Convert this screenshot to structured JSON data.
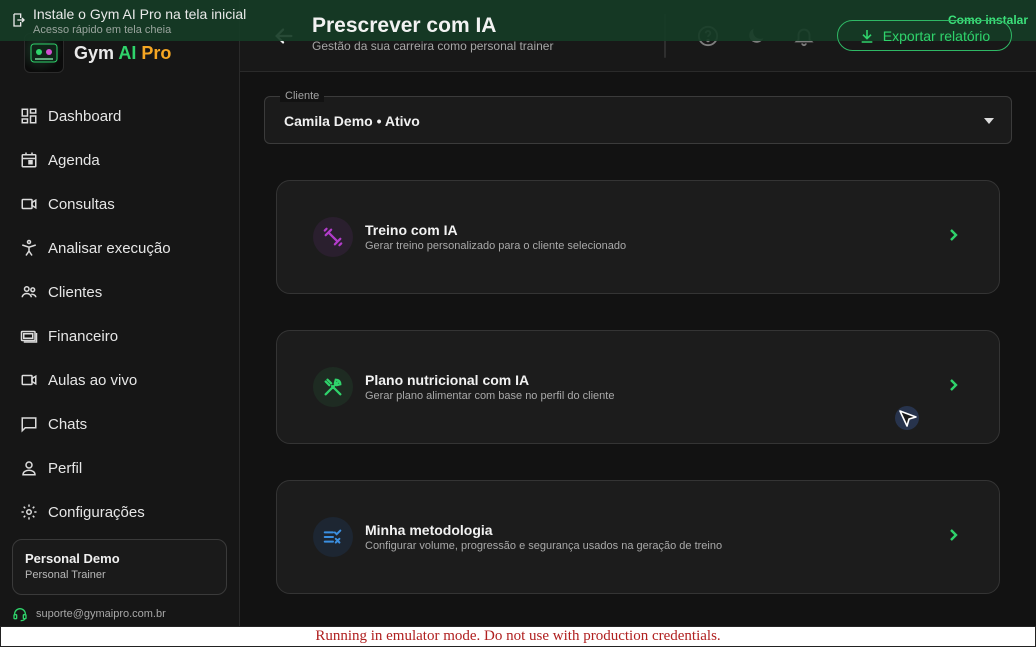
{
  "install_banner": {
    "title": "Instale o Gym AI Pro na tela inicial",
    "subtitle": "Acesso rápido em tela cheia",
    "action": "Como instalar"
  },
  "brand": {
    "name_part1": "Gym ",
    "name_part2": "AI",
    "name_part3": " Pro"
  },
  "sidebar": {
    "items": [
      {
        "label": "Dashboard",
        "icon": "dashboard-icon"
      },
      {
        "label": "Agenda",
        "icon": "calendar-icon"
      },
      {
        "label": "Consultas",
        "icon": "video-icon"
      },
      {
        "label": "Analisar execução",
        "icon": "gymnast-icon"
      },
      {
        "label": "Clientes",
        "icon": "people-icon"
      },
      {
        "label": "Financeiro",
        "icon": "money-icon"
      },
      {
        "label": "Aulas ao vivo",
        "icon": "live-video-icon"
      },
      {
        "label": "Chats",
        "icon": "chat-icon"
      },
      {
        "label": "Perfil",
        "icon": "person-icon"
      },
      {
        "label": "Configurações",
        "icon": "gear-icon"
      }
    ],
    "user": {
      "name": "Personal Demo",
      "role": "Personal Trainer"
    },
    "support_email": "suporte@gymaipro.com.br"
  },
  "header": {
    "title": "Prescrever com IA",
    "subtitle": "Gestão da sua carreira como personal trainer",
    "export_label": "Exportar relatório"
  },
  "client_select": {
    "legend": "Cliente",
    "value": "Camila Demo • Ativo"
  },
  "cards": [
    {
      "title": "Treino com IA",
      "description": "Gerar treino personalizado para o cliente selecionado",
      "icon": "dumbbell-icon",
      "accent": "#b13cc9"
    },
    {
      "title": "Plano nutricional com IA",
      "description": "Gerar plano alimentar com base no perfil do cliente",
      "icon": "utensils-icon",
      "accent": "#2fd36b"
    },
    {
      "title": "Minha metodologia",
      "description": "Configurar volume, progressão e segurança usados na geração de treino",
      "icon": "rule-list-icon",
      "accent": "#3b8fe0"
    }
  ],
  "colors": {
    "accent_green": "#2fd36b",
    "background": "#121212",
    "pro_orange": "#f5a623"
  },
  "emulator_notice": "Running in emulator mode. Do not use with production credentials."
}
